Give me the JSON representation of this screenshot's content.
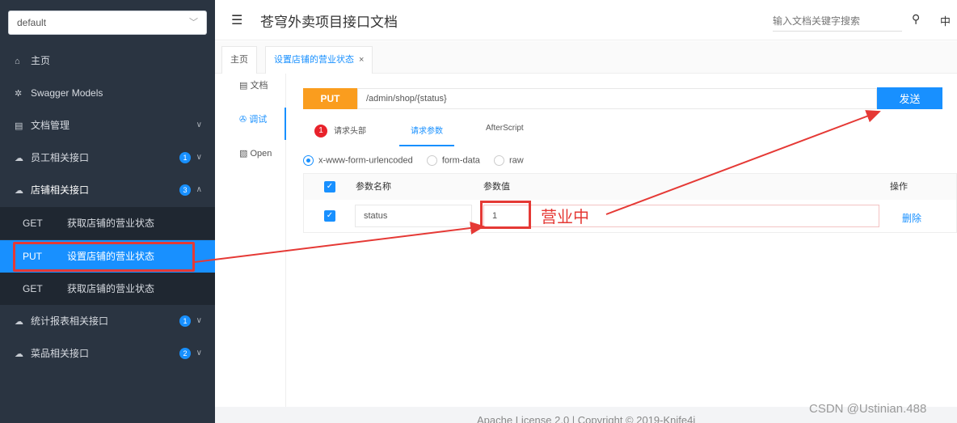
{
  "sidebar": {
    "group_select": "default",
    "items": [
      {
        "label": "主页",
        "icon": "home-icon"
      },
      {
        "label": "Swagger Models",
        "icon": "gear-icon"
      },
      {
        "label": "文档管理",
        "icon": "folder-icon"
      },
      {
        "label": "员工相关接口",
        "icon": "cloud-icon",
        "badge": "1"
      },
      {
        "label": "店铺相关接口",
        "icon": "cloud-icon",
        "badge": "3"
      },
      {
        "label": "统计报表相关接口",
        "icon": "cloud-icon",
        "badge": "1"
      },
      {
        "label": "菜品相关接口",
        "icon": "cloud-icon",
        "badge": "2"
      }
    ],
    "sub_items": [
      {
        "method": "GET",
        "label": "获取店铺的营业状态"
      },
      {
        "method": "PUT",
        "label": "设置店铺的营业状态"
      },
      {
        "method": "GET",
        "label": "获取店铺的营业状态"
      }
    ]
  },
  "header": {
    "title": "苍穹外卖项目接口文档",
    "search_placeholder": "输入文档关键字搜索",
    "lang": "中"
  },
  "tabs": [
    {
      "label": "主页"
    },
    {
      "label": "设置店铺的营业状态"
    }
  ],
  "mini_nav": [
    {
      "label": "文档",
      "icon": "doc-icon"
    },
    {
      "label": "调试",
      "icon": "debug-icon"
    },
    {
      "label": "Open",
      "icon": "open-icon"
    }
  ],
  "request": {
    "method": "PUT",
    "url": "/admin/shop/{status}",
    "send_label": "发送"
  },
  "sub_tabs": {
    "headers_count": "1",
    "headers_label": "请求头部",
    "params_label": "请求参数",
    "afterscript_label": "AfterScript"
  },
  "content_types": [
    "x-www-form-urlencoded",
    "form-data",
    "raw"
  ],
  "params_table": {
    "headers": [
      "参数名称",
      "参数值",
      "操作"
    ],
    "rows": [
      {
        "name": "status",
        "value": "1",
        "action": "删除"
      }
    ]
  },
  "annotation": "营业中",
  "footer": "Apache License 2.0 | Copyright © 2019-Knife4j",
  "watermark": "CSDN @Ustinian.488",
  "colors": {
    "sidebar_bg": "#2a3441",
    "accent": "#1890ff",
    "put_method": "#fa9d1e",
    "annotation": "#e53935"
  }
}
